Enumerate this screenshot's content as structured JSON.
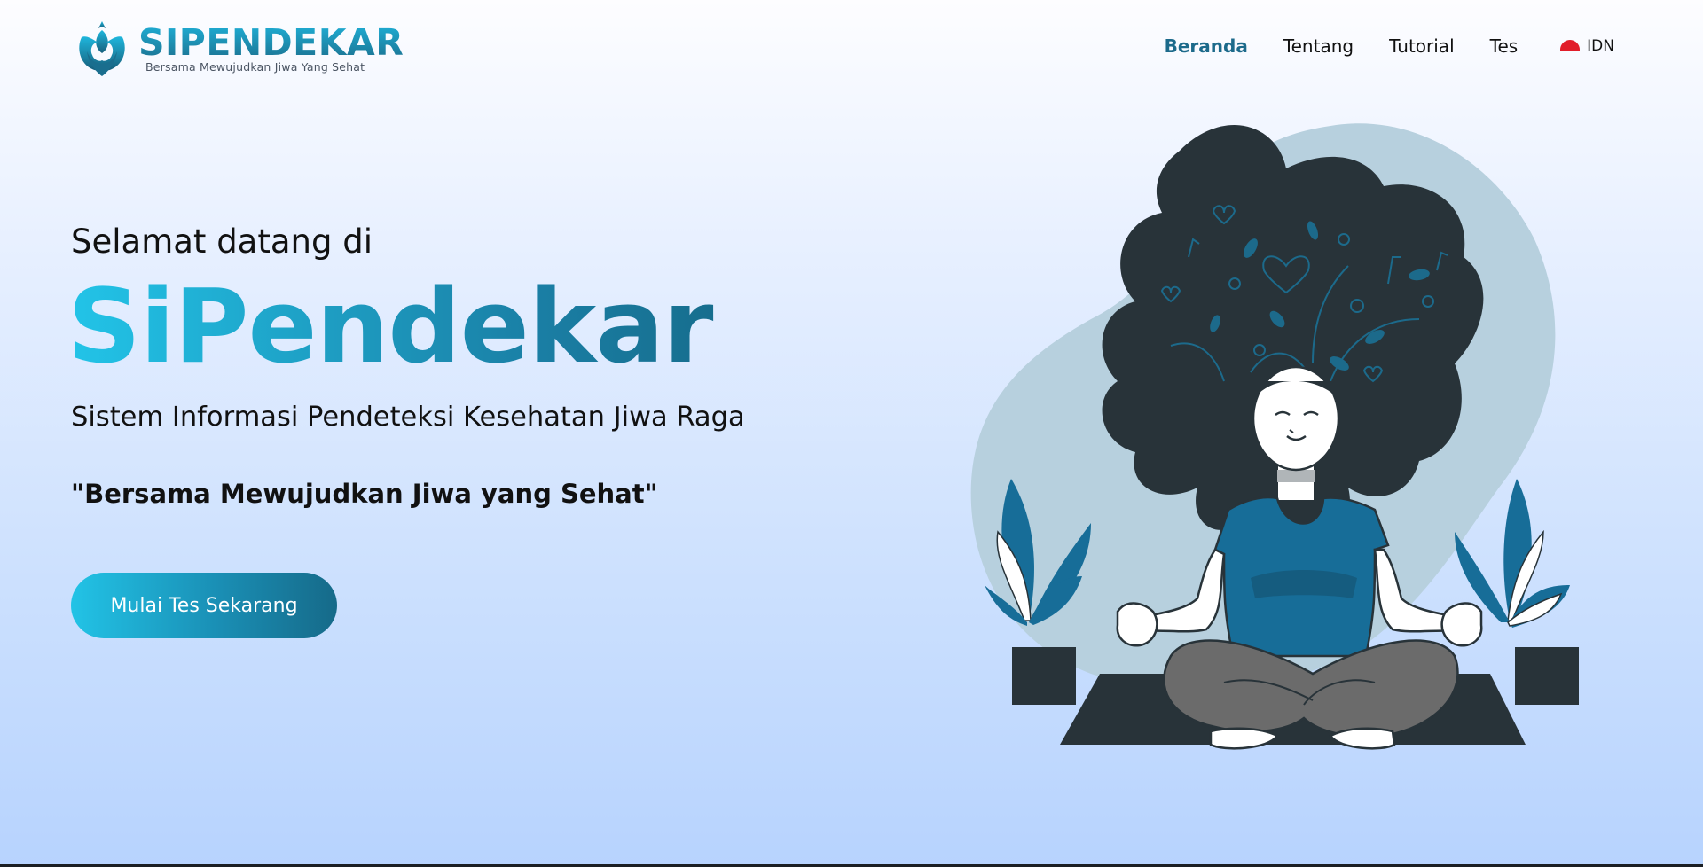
{
  "brand": {
    "name": "SIPENDEKAR",
    "tagline": "Bersama Mewujudkan Jiwa Yang Sehat"
  },
  "nav": {
    "items": [
      {
        "label": "Beranda",
        "active": true
      },
      {
        "label": "Tentang",
        "active": false
      },
      {
        "label": "Tutorial",
        "active": false
      },
      {
        "label": "Tes",
        "active": false
      }
    ],
    "language": {
      "label": "IDN",
      "icon": "indonesia-flag-icon"
    }
  },
  "hero": {
    "welcome": "Selamat datang di",
    "title": "SiPendekar",
    "subtitle": "Sistem Informasi Pendeteksi Kesehatan Jiwa Raga",
    "quote": "\"Bersama Mewujudkan Jiwa yang Sehat\"",
    "cta_label": "Mulai Tes Sekarang"
  },
  "colors": {
    "primary": "#1c6a8b",
    "accent": "#22c4e8",
    "dark": "#283339",
    "blob": "#b7d0de"
  }
}
